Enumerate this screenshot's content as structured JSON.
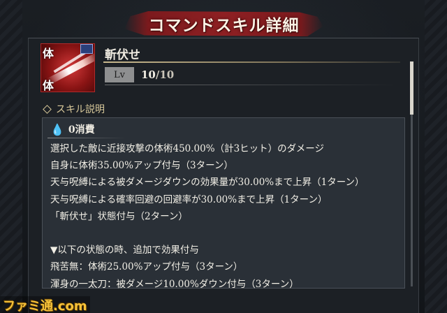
{
  "header": {
    "title": "コマンドスキル詳細"
  },
  "skill": {
    "icon_name": "slash-attack-icon",
    "icon_kanji_top": "体",
    "icon_kanji_bottom": "体",
    "name": "斬伏せ",
    "level_label": "Lv",
    "level_current": "10",
    "level_separator": "/",
    "level_max": "10"
  },
  "section": {
    "title": "スキル説明"
  },
  "description": {
    "cost_icon": "water-drop-icon",
    "cost": "0消費",
    "lines": [
      "選択した敵に近接攻撃の体術450.00%（計3ヒット）のダメージ",
      "自身に体術35.00%アップ付与（3ターン）",
      "天与呪縛による被ダメージダウンの効果量が30.00%まで上昇（1ターン）",
      "天与呪縛による確率回避の回避率が30.00%まで上昇（1ターン）",
      "「斬伏せ」状態付与（2ターン）",
      "",
      "▼以下の状態の時、追加で効果付与",
      "飛苦無：体術25.00%アップ付与（3ターン）",
      "渾身の一太刀：被ダメージ10.00%ダウン付与（3ターン）"
    ]
  },
  "watermark": {
    "text": "ファミ通.com"
  },
  "colors": {
    "banner": "#8e2023",
    "accent_gold": "#d8c89a",
    "panel_bg": "#1c2025",
    "desc_bg": "#2a3037"
  }
}
